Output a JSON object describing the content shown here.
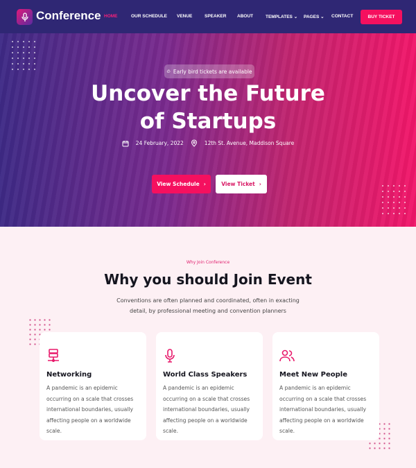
{
  "nav": {
    "brand": "Conference",
    "items": [
      "HOME",
      "OUR SCHEDULE",
      "VENUE",
      "SPEAKER",
      "ABOUT",
      "TEMPLATES",
      "PAGES",
      "CONTACT"
    ],
    "active": "HOME",
    "buy_label": "BUY TICKET"
  },
  "hero": {
    "badge": "Early bird tickets are available",
    "title_line1": "Uncover the Future",
    "title_line2": "of Startups",
    "date": "24 February, 2022",
    "location": "12th St. Avenue, Maddison Square",
    "btn_schedule": "View Schedule",
    "btn_ticket": "View Ticket"
  },
  "why": {
    "eyebrow": "Why Join Conference",
    "title": "Why you should Join Event",
    "desc_line1": "Conventions are often planned and coordinated, often in exacting",
    "desc_line2": "detail, by professional meeting and convention planners"
  },
  "cards": [
    {
      "icon": "network-icon",
      "title": "Networking",
      "text": "A pandemic is an epidemic occurring on a scale that crosses international boundaries, usually affecting people on a worldwide scale."
    },
    {
      "icon": "microphone-icon",
      "title": "World Class Speakers",
      "text": "A pandemic is an epidemic occurring on a scale that crosses international boundaries, usually affecting people on a worldwide scale."
    },
    {
      "icon": "users-icon",
      "title": "Meet New People",
      "text": "A pandemic is an epidemic occurring on a scale that crosses international boundaries, usually affecting people on a worldwide scale."
    }
  ],
  "colors": {
    "nav": "#2f2774",
    "accent": "#f5105f",
    "section_bg": "#fdf0f4"
  }
}
